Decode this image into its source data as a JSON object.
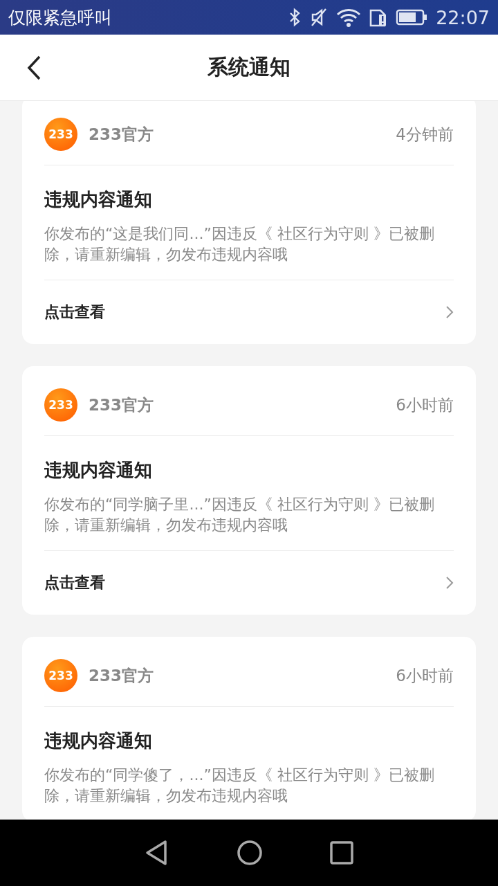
{
  "status_bar": {
    "carrier": "仅限紧急呼叫",
    "time": "22:07"
  },
  "header": {
    "title": "系统通知"
  },
  "notifications": [
    {
      "logo_text": "233",
      "sender": "233官方",
      "time": "4分钟前",
      "title": "违规内容通知",
      "body": "你发布的“这是我们同...”因违反《 社区行为守则 》已被删除，请重新编辑，勿发布违规内容哦",
      "link": "点击查看"
    },
    {
      "logo_text": "233",
      "sender": "233官方",
      "time": "6小时前",
      "title": "违规内容通知",
      "body": "你发布的“同学脑子里...”因违反《 社区行为守则 》已被删除，请重新编辑，勿发布违规内容哦",
      "link": "点击查看"
    },
    {
      "logo_text": "233",
      "sender": "233官方",
      "time": "6小时前",
      "title": "违规内容通知",
      "body": "你发布的“同学傻了，...”因违反《 社区行为守则 》已被删除，请重新编辑，勿发布违规内容哦"
    }
  ]
}
